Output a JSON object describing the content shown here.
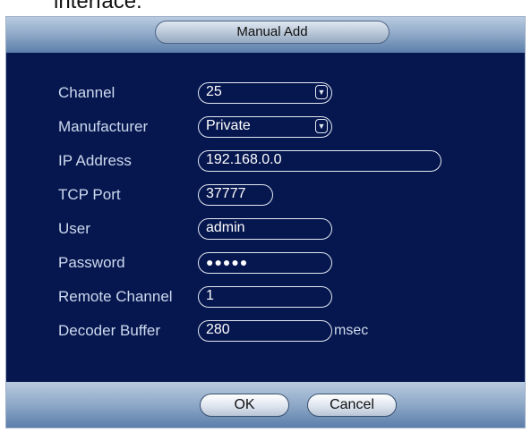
{
  "caption_text": "interface.",
  "dialog": {
    "title": "Manual Add",
    "fields": {
      "channel": {
        "label": "Channel",
        "value": "25"
      },
      "manufacturer": {
        "label": "Manufacturer",
        "value": "Private"
      },
      "ip_address": {
        "label": "IP Address",
        "value": "192.168.0.0"
      },
      "tcp_port": {
        "label": "TCP Port",
        "value": "37777"
      },
      "user": {
        "label": "User",
        "value": "admin"
      },
      "password": {
        "label": "Password",
        "value": "●●●●●"
      },
      "remote_channel": {
        "label": "Remote Channel",
        "value": "1"
      },
      "decoder_buffer": {
        "label": "Decoder Buffer",
        "value": "280",
        "unit": "msec"
      }
    },
    "buttons": {
      "ok": "OK",
      "cancel": "Cancel"
    }
  },
  "colors": {
    "panel_bg": "#06174f",
    "label_text": "#cdd9ee",
    "header_gradient_top": "#b9cbdf",
    "header_gradient_bottom": "#5b7eaa"
  },
  "icons": {
    "dropdown": "chevron-down-icon"
  }
}
